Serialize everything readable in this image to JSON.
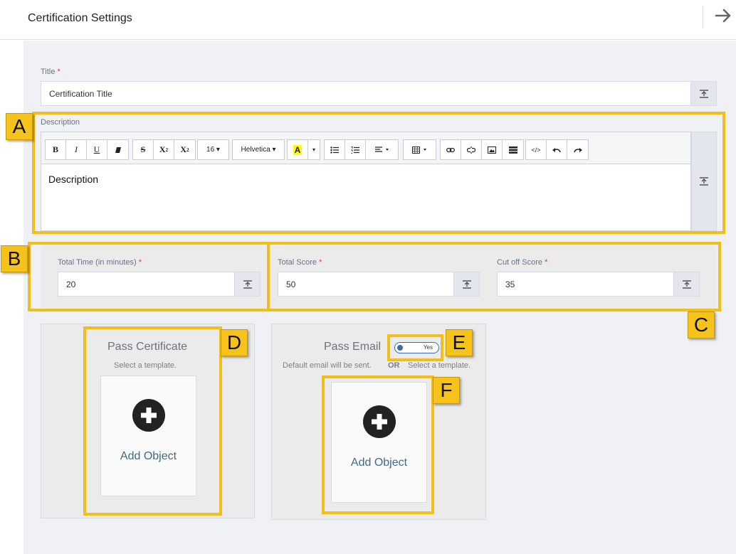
{
  "header": {
    "title": "Certification Settings",
    "exit_icon": "arrow-right-icon"
  },
  "title_field": {
    "label": "Title",
    "required_mark": "*",
    "value": "Certification Title"
  },
  "description": {
    "label": "Description",
    "body_text": "Description",
    "toolbar": {
      "bold": "B",
      "italic": "I",
      "underline": "U",
      "strike": "S",
      "superscript": "X",
      "subscript": "X",
      "font_size": "16 ▾",
      "font_family": "Helvetica ▾",
      "text_color": "A",
      "code": "</>"
    }
  },
  "total_time": {
    "label": "Total Time (in minutes)",
    "required_mark": "*",
    "value": "20"
  },
  "total_score": {
    "label": "Total Score",
    "required_mark": "*",
    "value": "50"
  },
  "cutoff_score": {
    "label": "Cut off Score",
    "required_mark": "*",
    "value": "35"
  },
  "pass_certificate": {
    "title": "Pass Certificate",
    "subtitle": "Select a template.",
    "add_label": "Add Object"
  },
  "pass_email": {
    "title": "Pass Email",
    "toggle_label": "Yes",
    "default_text": "Default email will be sent.",
    "or_text": "OR",
    "select_text": "Select a template.",
    "add_label": "Add Object"
  },
  "annotations": [
    "A",
    "B",
    "C",
    "D",
    "E",
    "F"
  ],
  "colors": {
    "highlight": "#f2be1a",
    "badge": "#f6c21c",
    "link": "#3f6a8a",
    "required": "#e0342e"
  }
}
